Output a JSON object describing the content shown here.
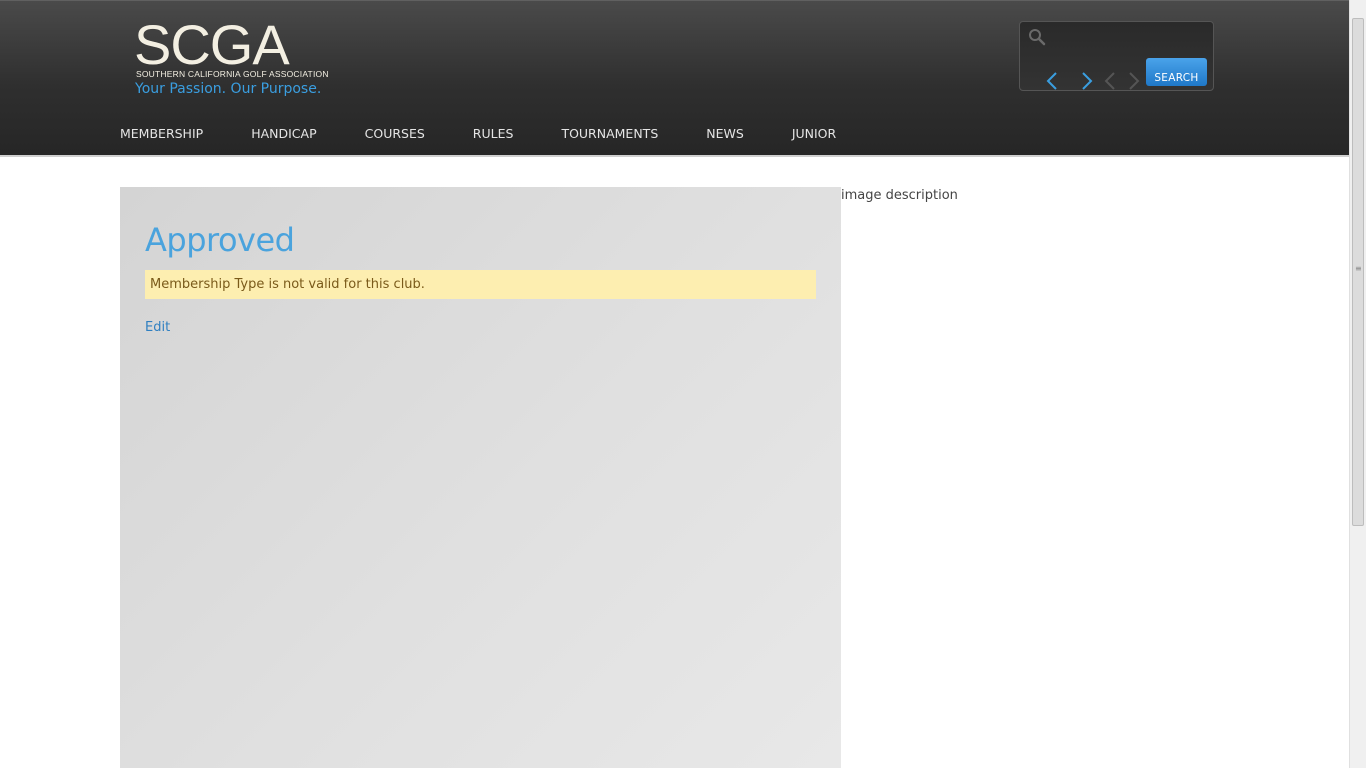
{
  "header": {
    "logo_text": "SCGA",
    "logo_subtitle": "SOUTHERN CALIFORNIA GOLF ASSOCIATION",
    "tagline": "Your Passion. Our Purpose."
  },
  "search": {
    "placeholder": "",
    "button_label": "SEARCH",
    "icon": "search-icon"
  },
  "nav": {
    "items": [
      {
        "label": "MEMBERSHIP"
      },
      {
        "label": "HANDICAP"
      },
      {
        "label": "COURSES"
      },
      {
        "label": "RULES"
      },
      {
        "label": "TOURNAMENTS"
      },
      {
        "label": "NEWS"
      },
      {
        "label": "JUNIOR"
      }
    ]
  },
  "main": {
    "title": "Approved",
    "alert_message": "Membership Type is not valid for this club.",
    "edit_link": "Edit"
  },
  "sidebar": {
    "image_alt": "image description"
  },
  "colors": {
    "accent": "#4aa3dd",
    "link": "#2f7fc1",
    "alert_bg": "#fdeeb0",
    "header_bg": "#2f2f2f",
    "button_blue": "#1f78c8"
  }
}
